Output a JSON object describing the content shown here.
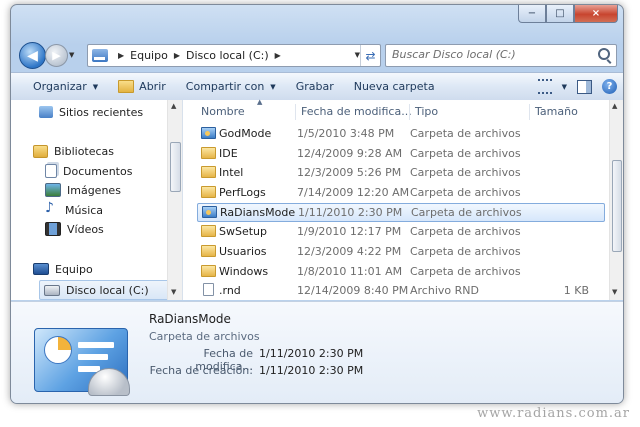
{
  "window": {
    "minimize": "−",
    "maximize": "□",
    "close": "×"
  },
  "address": {
    "crumbs": [
      "Equipo",
      "Disco local (C:)"
    ]
  },
  "search": {
    "placeholder": "Buscar Disco local (C:)"
  },
  "commands": {
    "organize": "Organizar",
    "open": "Abrir",
    "share": "Compartir con",
    "burn": "Grabar",
    "new_folder": "Nueva carpeta",
    "help": "?"
  },
  "navpane": {
    "items": [
      {
        "label": "Sitios recientes",
        "icon": "recent-places-icon"
      },
      {
        "label": "Bibliotecas",
        "icon": "libraries-icon"
      },
      {
        "label": "Documentos",
        "icon": "documents-icon"
      },
      {
        "label": "Imágenes",
        "icon": "pictures-icon"
      },
      {
        "label": "Música",
        "icon": "music-icon"
      },
      {
        "label": "Vídeos",
        "icon": "videos-icon"
      },
      {
        "label": "Equipo",
        "icon": "computer-icon"
      },
      {
        "label": "Disco local (C:)",
        "icon": "drive-icon"
      }
    ]
  },
  "columns": {
    "name": "Nombre",
    "date": "Fecha de modifica...",
    "type": "Tipo",
    "size": "Tamaño"
  },
  "files": [
    {
      "name": "GodMode",
      "date": "1/5/2010 3:48 PM",
      "type": "Carpeta de archivos",
      "size": "",
      "icon": "special"
    },
    {
      "name": "IDE",
      "date": "12/4/2009 9:28 AM",
      "type": "Carpeta de archivos",
      "size": "",
      "icon": "folder"
    },
    {
      "name": "Intel",
      "date": "12/3/2009 5:26 PM",
      "type": "Carpeta de archivos",
      "size": "",
      "icon": "folder"
    },
    {
      "name": "PerfLogs",
      "date": "7/14/2009 12:20 AM",
      "type": "Carpeta de archivos",
      "size": "",
      "icon": "folder"
    },
    {
      "name": "RaDiansMode",
      "date": "1/11/2010 2:30 PM",
      "type": "Carpeta de archivos",
      "size": "",
      "icon": "special"
    },
    {
      "name": "SwSetup",
      "date": "1/9/2010 12:17 PM",
      "type": "Carpeta de archivos",
      "size": "",
      "icon": "folder"
    },
    {
      "name": "Usuarios",
      "date": "12/3/2009 4:22 PM",
      "type": "Carpeta de archivos",
      "size": "",
      "icon": "folder"
    },
    {
      "name": "Windows",
      "date": "1/8/2010 11:01 AM",
      "type": "Carpeta de archivos",
      "size": "",
      "icon": "folder"
    },
    {
      "name": ".rnd",
      "date": "12/14/2009 8:40 PM",
      "type": "Archivo RND",
      "size": "1 KB",
      "icon": "file"
    }
  ],
  "details": {
    "title": "RaDiansMode",
    "type": "Carpeta de archivos",
    "modified_label": "Fecha de modifica...",
    "modified_value": "1/11/2010 2:30 PM",
    "created_label": "Fecha de creación:",
    "created_value": "1/11/2010 2:30 PM"
  },
  "watermark": "www.radians.com.ar"
}
